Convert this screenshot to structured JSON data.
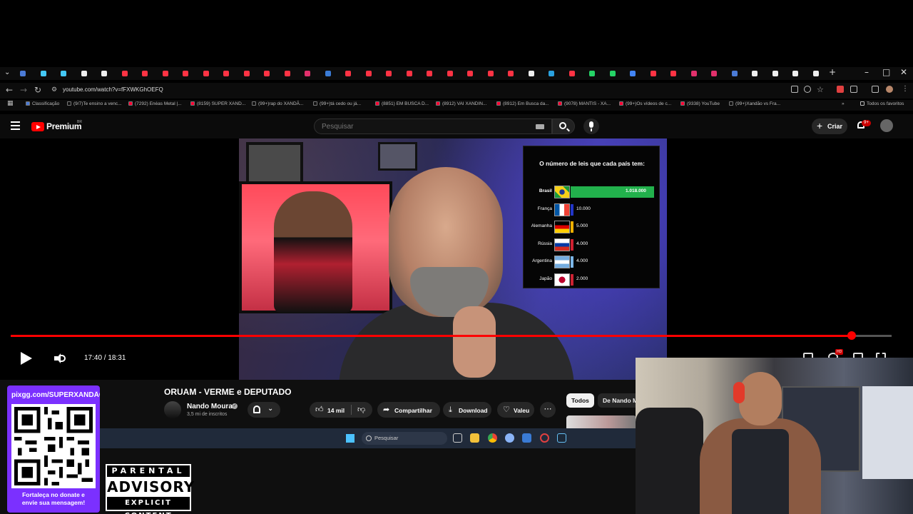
{
  "browser": {
    "url": "youtube.com/watch?v=fFXWKGhOEFQ",
    "bookmarks": [
      {
        "label": "Classificação",
        "color": "#4b7bd6"
      },
      {
        "label": "(9/7)Te ensino a venc...",
        "color": "#111111"
      },
      {
        "label": "(7292) Enéas Metal |...",
        "color": "#ff0033"
      },
      {
        "label": "(8159) SUPER XAND...",
        "color": "#ff0033"
      },
      {
        "label": "(99+)rap do XANDÃ...",
        "color": "#111111"
      },
      {
        "label": "(99+)tá cedo ou já...",
        "color": "#111111"
      },
      {
        "label": "(8851) EM BUSCA D...",
        "color": "#ff0033"
      },
      {
        "label": "(8912) VAI XANDIN...",
        "color": "#ff0033"
      },
      {
        "label": "(8912) Em Busca da...",
        "color": "#ff0033"
      },
      {
        "label": "(9078) MANTIS - XA...",
        "color": "#ff0033"
      },
      {
        "label": "(99+)Os vídeos de c...",
        "color": "#ff0033"
      },
      {
        "label": "(9338) YouTube",
        "color": "#ff0033"
      },
      {
        "label": "(99+)Xandão vs Fra...",
        "color": "#111111"
      }
    ],
    "all_favorites": "Todos os favoritos"
  },
  "youtube": {
    "brand": "Premium",
    "region": "BR",
    "search_placeholder": "Pesquisar",
    "create_label": "Criar",
    "notif_badge": "9+"
  },
  "infographic": {
    "title": "O número de leis que cada país tem:",
    "rows": [
      {
        "country": "Brasil",
        "value_label": "1.018.000",
        "value": 1018000,
        "bar_color": "#22b14c"
      },
      {
        "country": "França",
        "value_label": "10.000",
        "value": 10000,
        "bar_color": "#2235c8"
      },
      {
        "country": "Alemanha",
        "value_label": "5.000",
        "value": 5000,
        "bar_color": "#f0b000"
      },
      {
        "country": "Rússia",
        "value_label": "4.000",
        "value": 4000,
        "bar_color": "#d02030"
      },
      {
        "country": "Argentina",
        "value_label": "4.000",
        "value": 4000,
        "bar_color": "#7cb6e8"
      },
      {
        "country": "Japão",
        "value_label": "2.000",
        "value": 2000,
        "bar_color": "#cc2233"
      }
    ]
  },
  "player": {
    "time_display": "17:40 / 18:31",
    "progress": 0.955,
    "hd_badge": "HD"
  },
  "video": {
    "title": "ORUAM - VERME e DEPUTADO",
    "channel": "Nando Moura",
    "subscribers": "3,5 mi de inscritos",
    "likes": "14 mil",
    "share_label": "Compartilhar",
    "download_label": "Download",
    "thanks_label": "Valeu"
  },
  "chips": [
    "Todos",
    "De Nando M"
  ],
  "taskbar": {
    "search_label": "Pesquisar"
  },
  "overlay": {
    "donate_url": "pixgg.com/SUPERXANDÃO",
    "donate_message_1": "Fortaleça no donate e",
    "donate_message_2": "envie sua mensagem!",
    "advisory_top": "PARENTAL",
    "advisory_mid": "ADVISORY",
    "advisory_bot": "EXPLICIT CONTENT"
  }
}
